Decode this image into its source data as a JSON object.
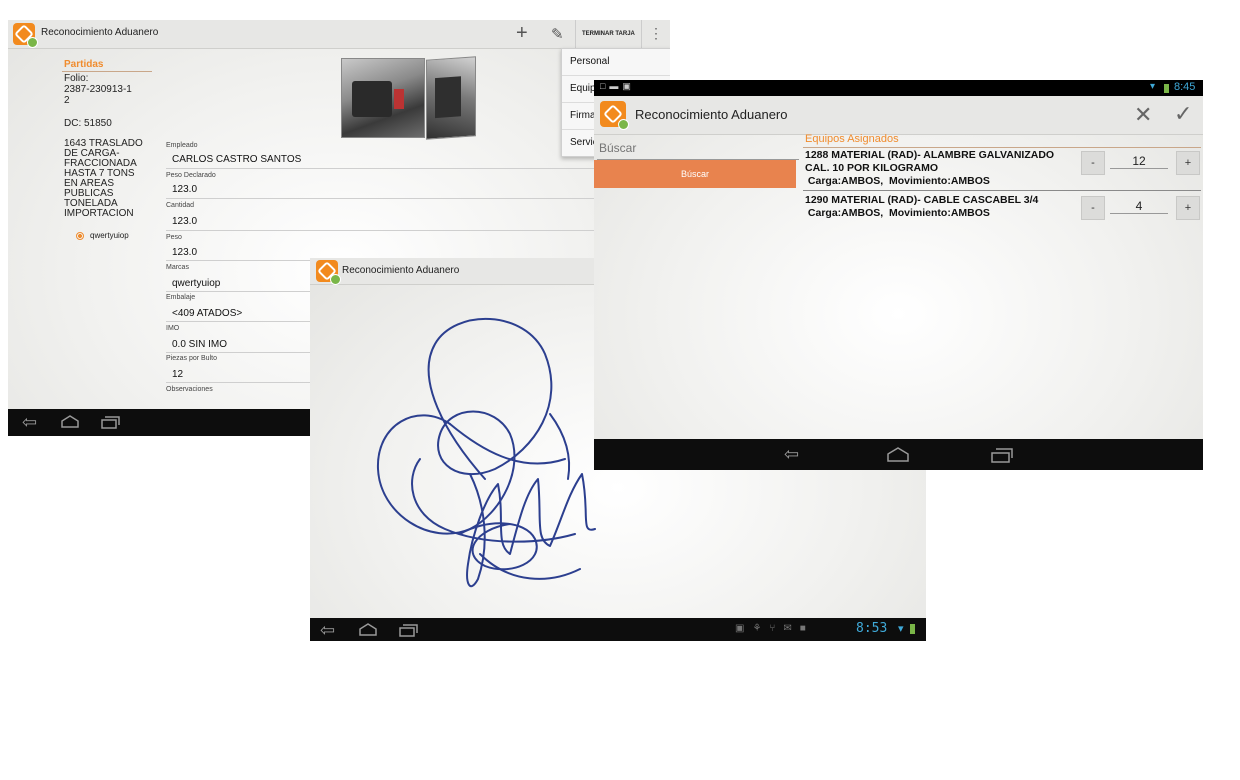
{
  "screen1": {
    "title": "Reconocimiento Aduanero",
    "actions": {
      "add": "+",
      "edit": "✎",
      "finish": "TERMINAR TARJA",
      "overflow": "⋮"
    },
    "partidas_header": "Partidas",
    "folio_label": "Folio:",
    "folio_value": "2387-230913-1",
    "folio_suffix": "2",
    "dc": "DC: 51850",
    "description_lines": [
      "1643 TRASLADO",
      "DE CARGA-",
      "FRACCIONADA",
      "HASTA 7 TONS",
      "EN AREAS",
      "PUBLICAS",
      "TONELADA",
      "IMPORTACION"
    ],
    "radio_label": "qwertyuiop",
    "fields": [
      {
        "label": "Empleado",
        "value": "CARLOS CASTRO SANTOS"
      },
      {
        "label": "Peso Declarado",
        "value": "123.0"
      },
      {
        "label": "Cantidad",
        "value": "123.0"
      },
      {
        "label": "Peso",
        "value": "123.0"
      },
      {
        "label": "Marcas",
        "value": "qwertyuiop"
      },
      {
        "label": "Embalaje",
        "value": "<409 ATADOS>"
      },
      {
        "label": "IMO",
        "value": "0.0 SIN IMO"
      },
      {
        "label": "Piezas por Bulto",
        "value": "12"
      },
      {
        "label": "Observaciones",
        "value": ""
      }
    ],
    "menu": [
      "Personal",
      "Equip",
      "Firma",
      "Servic"
    ]
  },
  "screen2": {
    "title": "Reconocimiento Aduanero",
    "status_time": "8:53"
  },
  "screen3": {
    "status_time": "8:45",
    "title": "Reconocimiento Aduanero",
    "search_placeholder": "Búscar",
    "search_button": "Búscar",
    "section_header": "Equipos Asignados",
    "items": [
      {
        "line1": "1288 MATERIAL (RAD)- ALAMBRE GALVANIZADO",
        "line2": "CAL. 10 POR KILOGRAMO",
        "line3": " Carga:AMBOS,  Movimiento:AMBOS",
        "qty": "12"
      },
      {
        "line1": "1290 MATERIAL (RAD)- CABLE CASCABEL 3/4",
        "line2": " Carga:AMBOS,  Movimiento:AMBOS",
        "qty": "4"
      }
    ],
    "minus": "-",
    "plus": "+"
  },
  "icons": {
    "back": "back-icon",
    "home": "home-icon",
    "recents": "recents-icon",
    "close": "close-icon",
    "check": "check-icon",
    "wifi": "wifi-icon",
    "battery": "battery-icon"
  },
  "colors": {
    "accent": "#f08c2e",
    "search_button": "#e8834e",
    "signature": "#2c3f8f",
    "navbar": "#0d0d0d"
  }
}
